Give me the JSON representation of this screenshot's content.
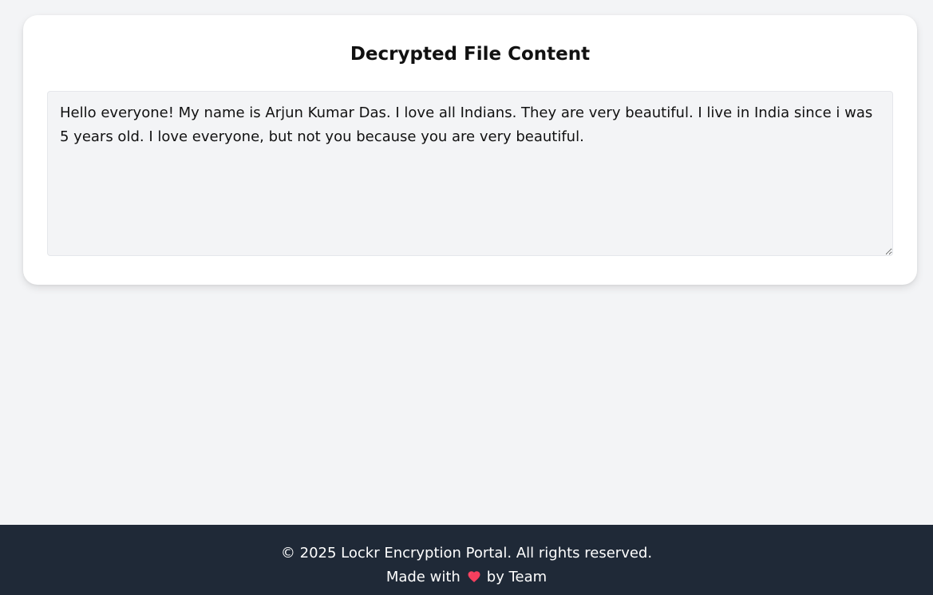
{
  "decrypted_card": {
    "title": "Decrypted File Content",
    "content": "Hello everyone! My name is Arjun Kumar Das. I love all Indians. They are very beautiful. I live in India since i was 5 years old. I love everyone, but not you because you are very beautiful."
  },
  "footer": {
    "copyright": "© 2025 Lockr Encryption Portal. All rights reserved.",
    "made_with": "Made with",
    "by_team": "by Team",
    "heart_icon": "heart-icon",
    "heart_color": "#f43f5e"
  },
  "colors": {
    "page_background": "#f3f4f6",
    "card_background": "#ffffff",
    "textarea_background": "#f3f4f6",
    "footer_background": "#1f2937",
    "footer_text": "#ffffff"
  }
}
